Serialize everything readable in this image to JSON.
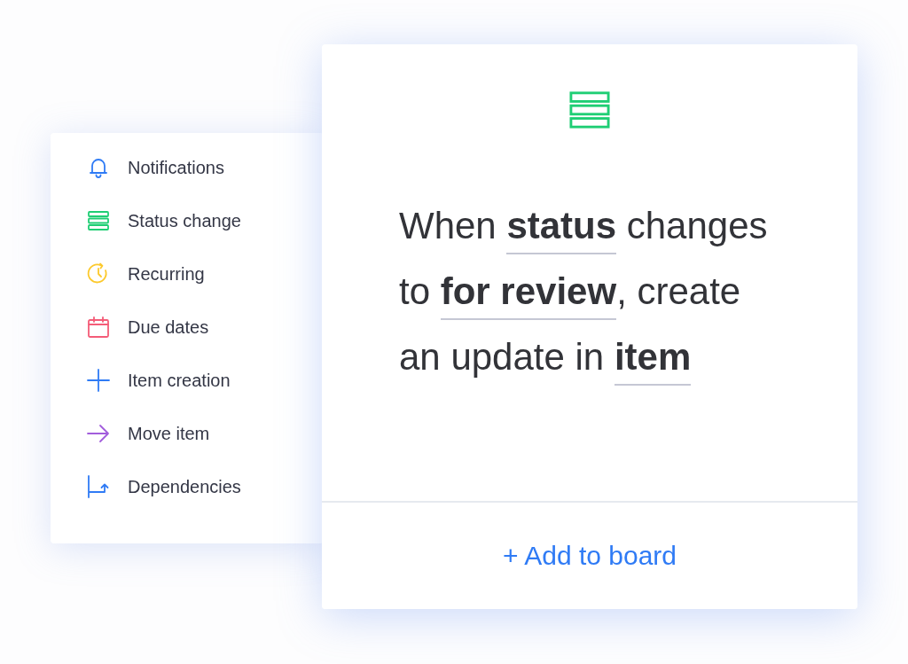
{
  "triggers": [
    {
      "label": "Notifications",
      "kind": "bell",
      "color": "#2f7bf5"
    },
    {
      "label": "Status change",
      "kind": "stack",
      "color": "#1fce74"
    },
    {
      "label": "Recurring",
      "kind": "clock",
      "color": "#fcc92c"
    },
    {
      "label": "Due dates",
      "kind": "calendar",
      "color": "#f45c78"
    },
    {
      "label": "Item creation",
      "kind": "plus",
      "color": "#2f7bf5"
    },
    {
      "label": "Move item",
      "kind": "arrow",
      "color": "#a25ddc"
    },
    {
      "label": "Dependencies",
      "kind": "dependency",
      "color": "#2f7bf5"
    }
  ],
  "recipe": {
    "parts": [
      {
        "kind": "text",
        "text": "When "
      },
      {
        "kind": "field",
        "text": "status"
      },
      {
        "kind": "text",
        "text": " changes to "
      },
      {
        "kind": "field",
        "text": "for review"
      },
      {
        "kind": "text",
        "text": ", create an update in "
      },
      {
        "kind": "field",
        "text": "item"
      }
    ]
  },
  "action": "+ Add to board"
}
